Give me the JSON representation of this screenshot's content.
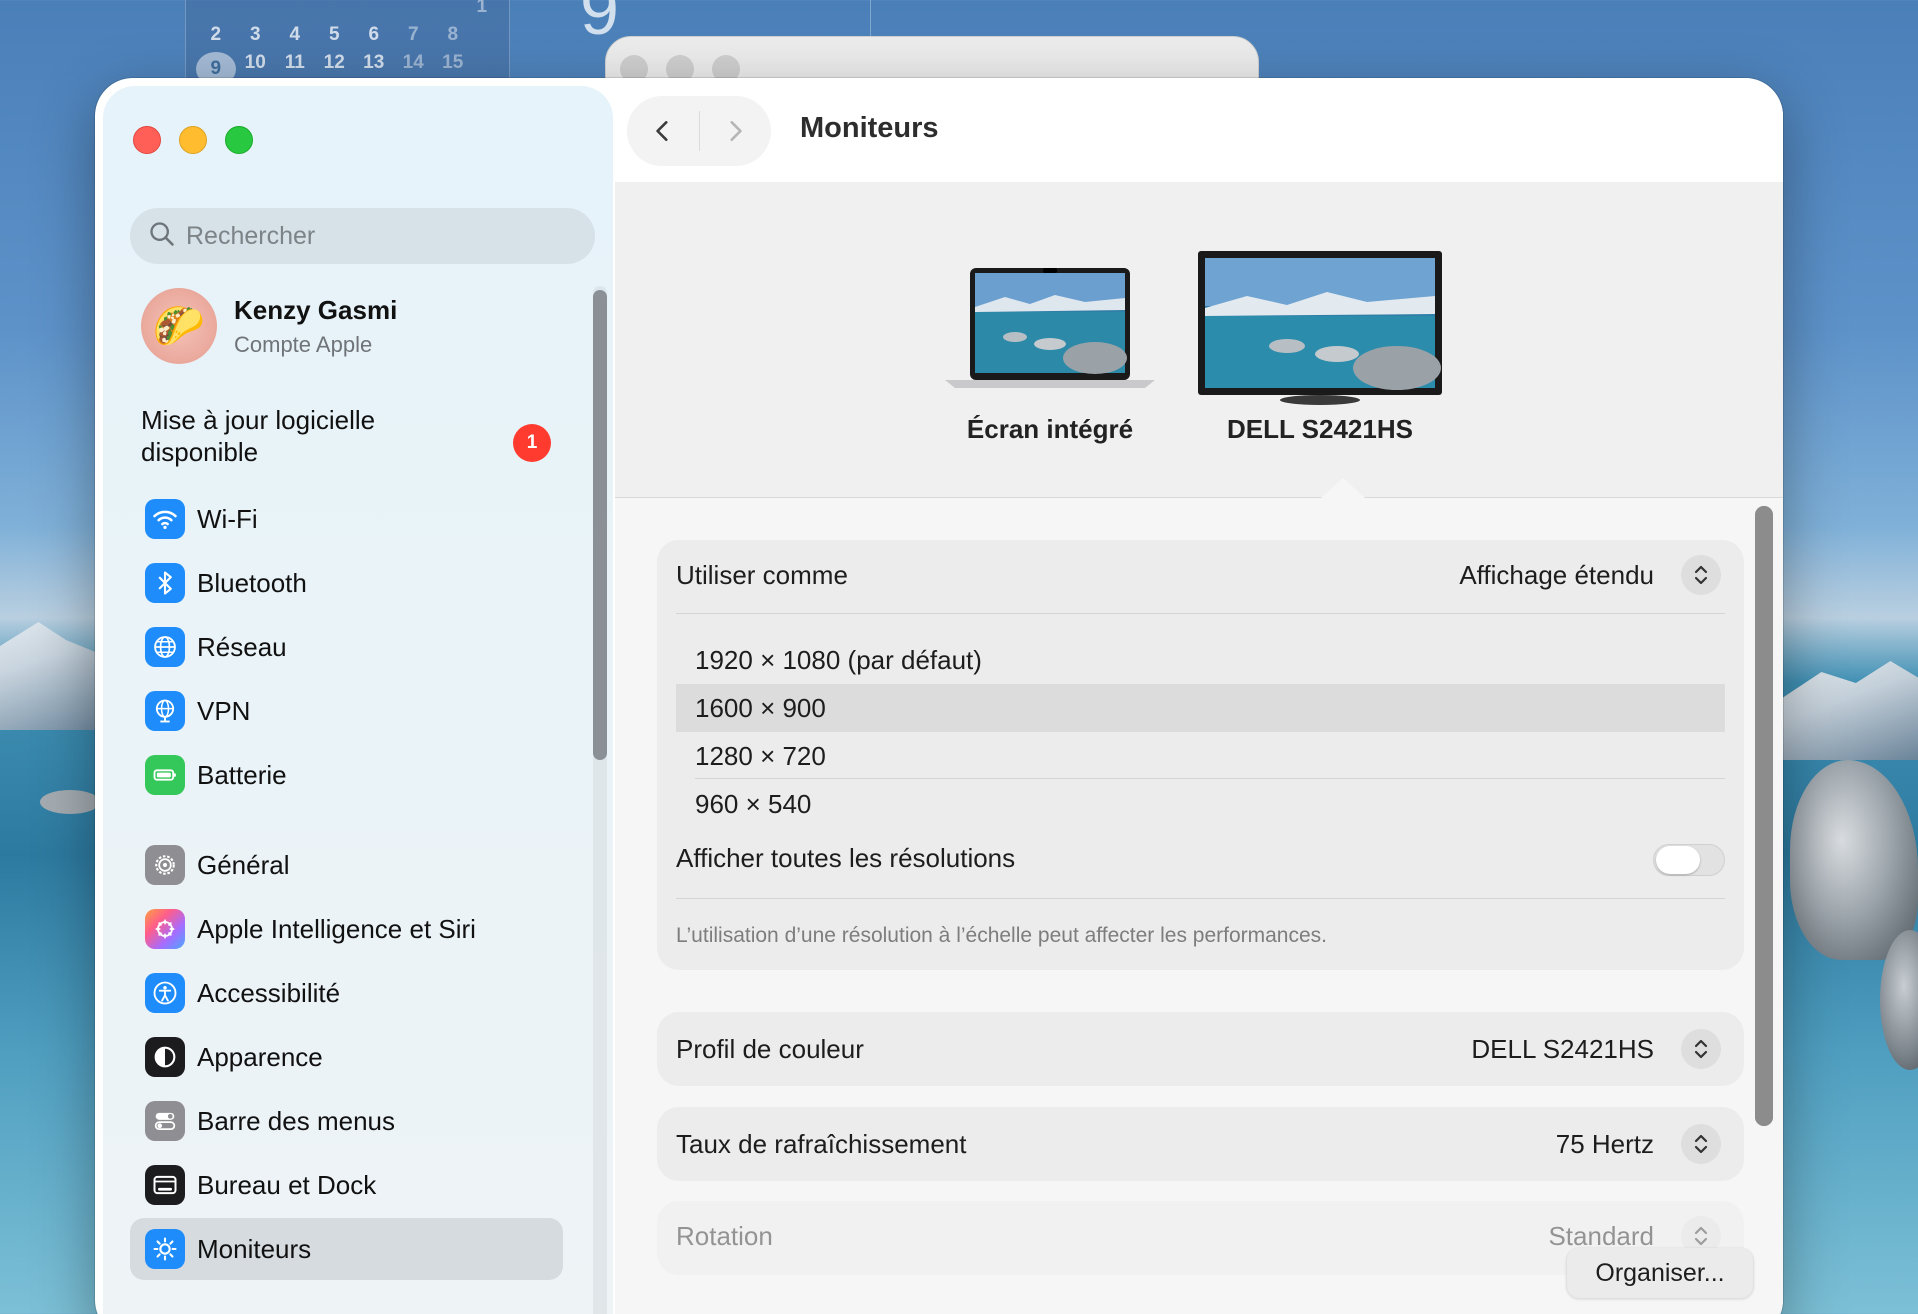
{
  "calendar": {
    "row0": [
      "1"
    ],
    "row1": [
      "2",
      "3",
      "4",
      "5",
      "6",
      "7",
      "8"
    ],
    "row2": [
      "9",
      "10",
      "11",
      "12",
      "13",
      "14",
      "15"
    ],
    "big_day": "9"
  },
  "sidebar": {
    "search_placeholder": "Rechercher",
    "account": {
      "name": "Kenzy Gasmi",
      "subtitle": "Compte Apple"
    },
    "update": {
      "text": "Mise à jour logicielle disponible",
      "badge": "1"
    },
    "items": [
      {
        "label": "Wi-Fi",
        "icon": "wifi-icon",
        "color": "#1e8dfb"
      },
      {
        "label": "Bluetooth",
        "icon": "bluetooth-icon",
        "color": "#1e8dfb"
      },
      {
        "label": "Réseau",
        "icon": "globe-icon",
        "color": "#1e8dfb"
      },
      {
        "label": "VPN",
        "icon": "vpn-globe-icon",
        "color": "#1e8dfb"
      },
      {
        "label": "Batterie",
        "icon": "battery-icon",
        "color": "#34c759"
      },
      {
        "label": "Général",
        "icon": "gear-icon",
        "color": "#8e8e93"
      },
      {
        "label": "Apple Intelligence et Siri",
        "icon": "siri-icon",
        "color": "#ff6f91"
      },
      {
        "label": "Accessibilité",
        "icon": "accessibility-icon",
        "color": "#1e8dfb"
      },
      {
        "label": "Apparence",
        "icon": "appearance-icon",
        "color": "#1c1c1e"
      },
      {
        "label": "Barre des menus",
        "icon": "menubar-icon",
        "color": "#8e8e93"
      },
      {
        "label": "Bureau et Dock",
        "icon": "dock-icon",
        "color": "#1c1c1e"
      },
      {
        "label": "Moniteurs",
        "icon": "brightness-icon",
        "color": "#1e8dfb",
        "active": true
      }
    ]
  },
  "toolbar": {
    "title": "Moniteurs"
  },
  "displays": [
    {
      "name": "Écran intégré"
    },
    {
      "name": "DELL S2421HS",
      "selected": true
    }
  ],
  "settings": {
    "use_as": {
      "label": "Utiliser comme",
      "value": "Affichage étendu"
    },
    "resolutions": [
      {
        "label": "1920 × 1080 (par défaut)",
        "selected": false
      },
      {
        "label": "1600 × 900",
        "selected": true
      },
      {
        "label": "1280 × 720",
        "selected": false
      },
      {
        "label": "960 × 540",
        "selected": false
      }
    ],
    "show_all": {
      "label": "Afficher toutes les résolutions",
      "on": false
    },
    "note": "L’utilisation d’une résolution à l’échelle peut affecter les performances.",
    "color_profile": {
      "label": "Profil de couleur",
      "value": "DELL S2421HS"
    },
    "refresh_rate": {
      "label": "Taux de rafraîchissement",
      "value": "75 Hertz"
    },
    "rotation": {
      "label": "Rotation",
      "value": "Standard"
    }
  },
  "organize_button": "Organiser..."
}
